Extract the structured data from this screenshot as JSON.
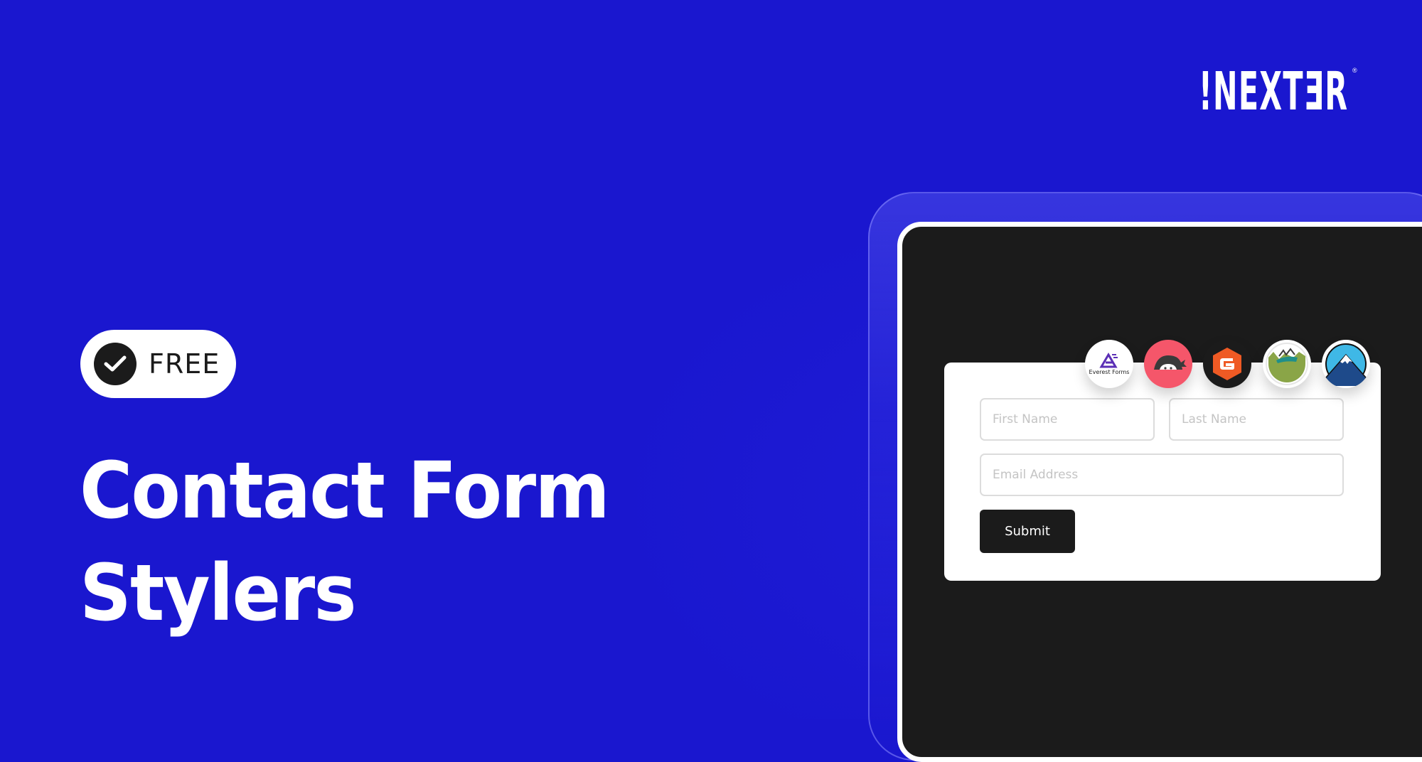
{
  "brand": {
    "logo_text": "!NEXTƎR",
    "registered_mark": "®"
  },
  "badge": {
    "label": "FREE",
    "icon": "check-circle-icon"
  },
  "headline": {
    "line1": "Contact Form",
    "line2": "Stylers"
  },
  "form": {
    "first_name_placeholder": "First Name",
    "last_name_placeholder": "Last Name",
    "email_placeholder": "Email Address",
    "submit_label": "Submit"
  },
  "plugin_logos": [
    {
      "name": "Everest Forms",
      "icon": "everest-forms-icon",
      "label": "Everest Forms",
      "bg": "#ffffff",
      "accent": "#5b2fb5"
    },
    {
      "name": "Ninja Forms",
      "icon": "ninja-forms-icon",
      "bg": "#f5566a",
      "accent": "#3a3a3a"
    },
    {
      "name": "Gravity Forms",
      "icon": "gravity-forms-icon",
      "bg": "#1b1b1b",
      "accent": "#ef5a24"
    },
    {
      "name": "WPForms-style landscape",
      "icon": "landscape-icon",
      "bg": "#ffffff",
      "accent": "#8aa547"
    },
    {
      "name": "Mountain badge",
      "icon": "mountain-icon",
      "bg": "#ffffff",
      "accent": "#1e4a8a"
    }
  ],
  "colors": {
    "background": "#1a17cf",
    "device_screen": "#1b1b1b",
    "card": "#ffffff",
    "button": "#1b1b1b"
  }
}
